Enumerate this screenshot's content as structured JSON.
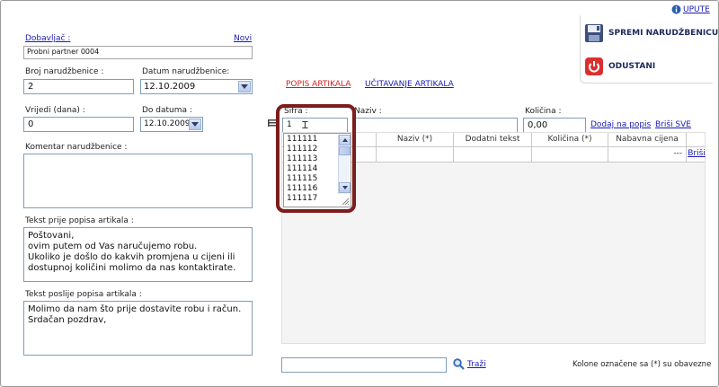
{
  "header": {
    "help_link": "UPUTE"
  },
  "actions": {
    "save_label": "SPREMI NARUDŽBENICU",
    "cancel_label": "ODUSTANI"
  },
  "left": {
    "supplier_label": "Dobavljač :",
    "new_link": "Novi",
    "supplier_value": "Probni partner 0004",
    "order_no_label": "Broj narudžbenice :",
    "order_no_value": "2",
    "order_date_label": "Datum narudžbenice:",
    "order_date_value": "12.10.2009",
    "valid_label": "Vrijedi (dana)  :",
    "valid_value": "0",
    "until_label": "Do datuma :",
    "until_value": "12.10.2009",
    "comment_label": "Komentar narudžbenice :",
    "comment_value": "",
    "text_before_label": "Tekst prije popisa artikala :",
    "text_before_value": "Poštovani,\novim putem od Vas naručujemo robu.\nUkoliko je došlo do kakvih promjena u cijeni ili\ndostupnoj količini molimo da nas kontaktirate.",
    "text_after_label": "Tekst poslije popisa artikala :",
    "text_after_value": "Molimo da nam što prije dostavite robu i račun.\nSrdačan pozdrav,"
  },
  "tabs": [
    {
      "label": "POPIS ARTIKALA",
      "active": true
    },
    {
      "label": "UČITAVANJE ARTIKALA",
      "active": false
    }
  ],
  "entry": {
    "code_label": "Šifra :",
    "code_value": "1",
    "name_label": "Naziv :",
    "name_value": "",
    "qty_label": "Količina :",
    "qty_value": "0,00",
    "add_link": "Dodaj na popis",
    "delete_all_link": "Briši SVE"
  },
  "dropdown": {
    "items": [
      "111111",
      "111112",
      "111113",
      "111114",
      "111115",
      "111116",
      "111117"
    ]
  },
  "grid": {
    "columns": [
      "Naziv (*)",
      "Dodatni tekst",
      "Količina (*)",
      "Nabavna cijena"
    ],
    "row": {
      "price": "---",
      "delete_link": "Briši"
    }
  },
  "footer": {
    "search_value": "",
    "search_link": "Traži",
    "note": "Kolone označene sa (*) su obavezne"
  },
  "colors": {
    "accent_link": "#1a1ab8",
    "active_tab": "#d42020",
    "highlight": "#7d1c1c"
  }
}
